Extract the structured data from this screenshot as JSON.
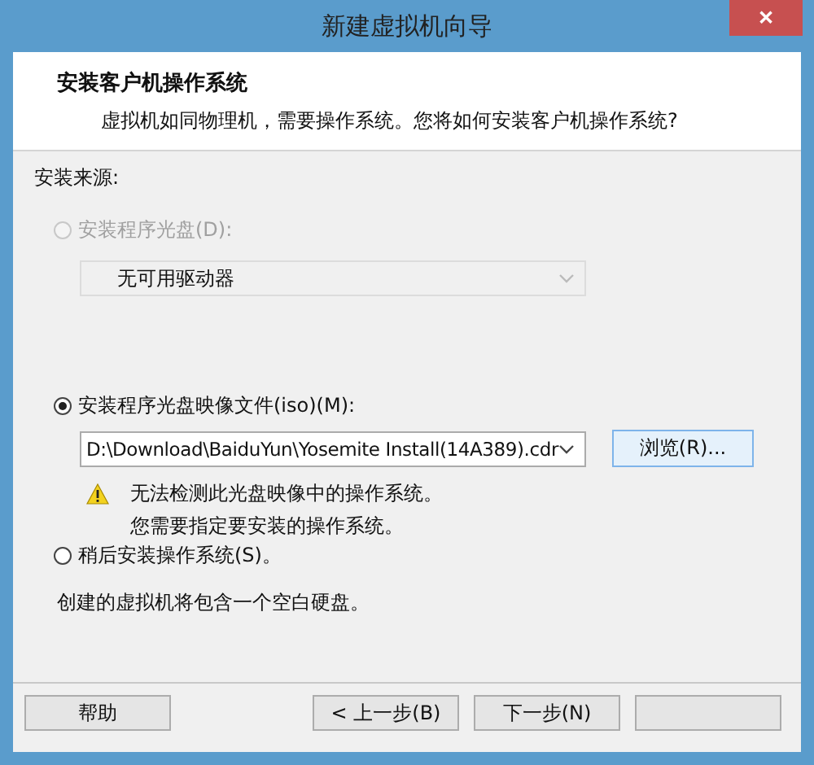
{
  "window": {
    "title": "新建虚拟机向导",
    "close": "✕"
  },
  "header": {
    "title": "安装客户机操作系统",
    "subtitle": "虚拟机如同物理机，需要操作系统。您将如何安装客户机操作系统?"
  },
  "source_label": "安装来源:",
  "options": [
    {
      "kind": "drive",
      "label": "安装程序光盘(D):",
      "selected": false,
      "disabled": true,
      "value": "无可用驱动器"
    },
    {
      "kind": "iso",
      "label": "安装程序光盘映像文件(iso)(M):",
      "selected": true,
      "disabled": false,
      "value": "D:\\Download\\BaiduYun\\Yosemite Install(14A389).cdr",
      "browse": "浏览(R)...",
      "warning": [
        "无法检测此光盘映像中的操作系统。",
        "您需要指定要安装的操作系统。"
      ]
    },
    {
      "kind": "later",
      "label": "稍后安装操作系统(S)。",
      "selected": false,
      "disabled": false,
      "note": "创建的虚拟机将包含一个空白硬盘。"
    }
  ],
  "buttons": {
    "help": "帮助",
    "back": "< 上一步(B)",
    "next": "下一步(N)"
  }
}
